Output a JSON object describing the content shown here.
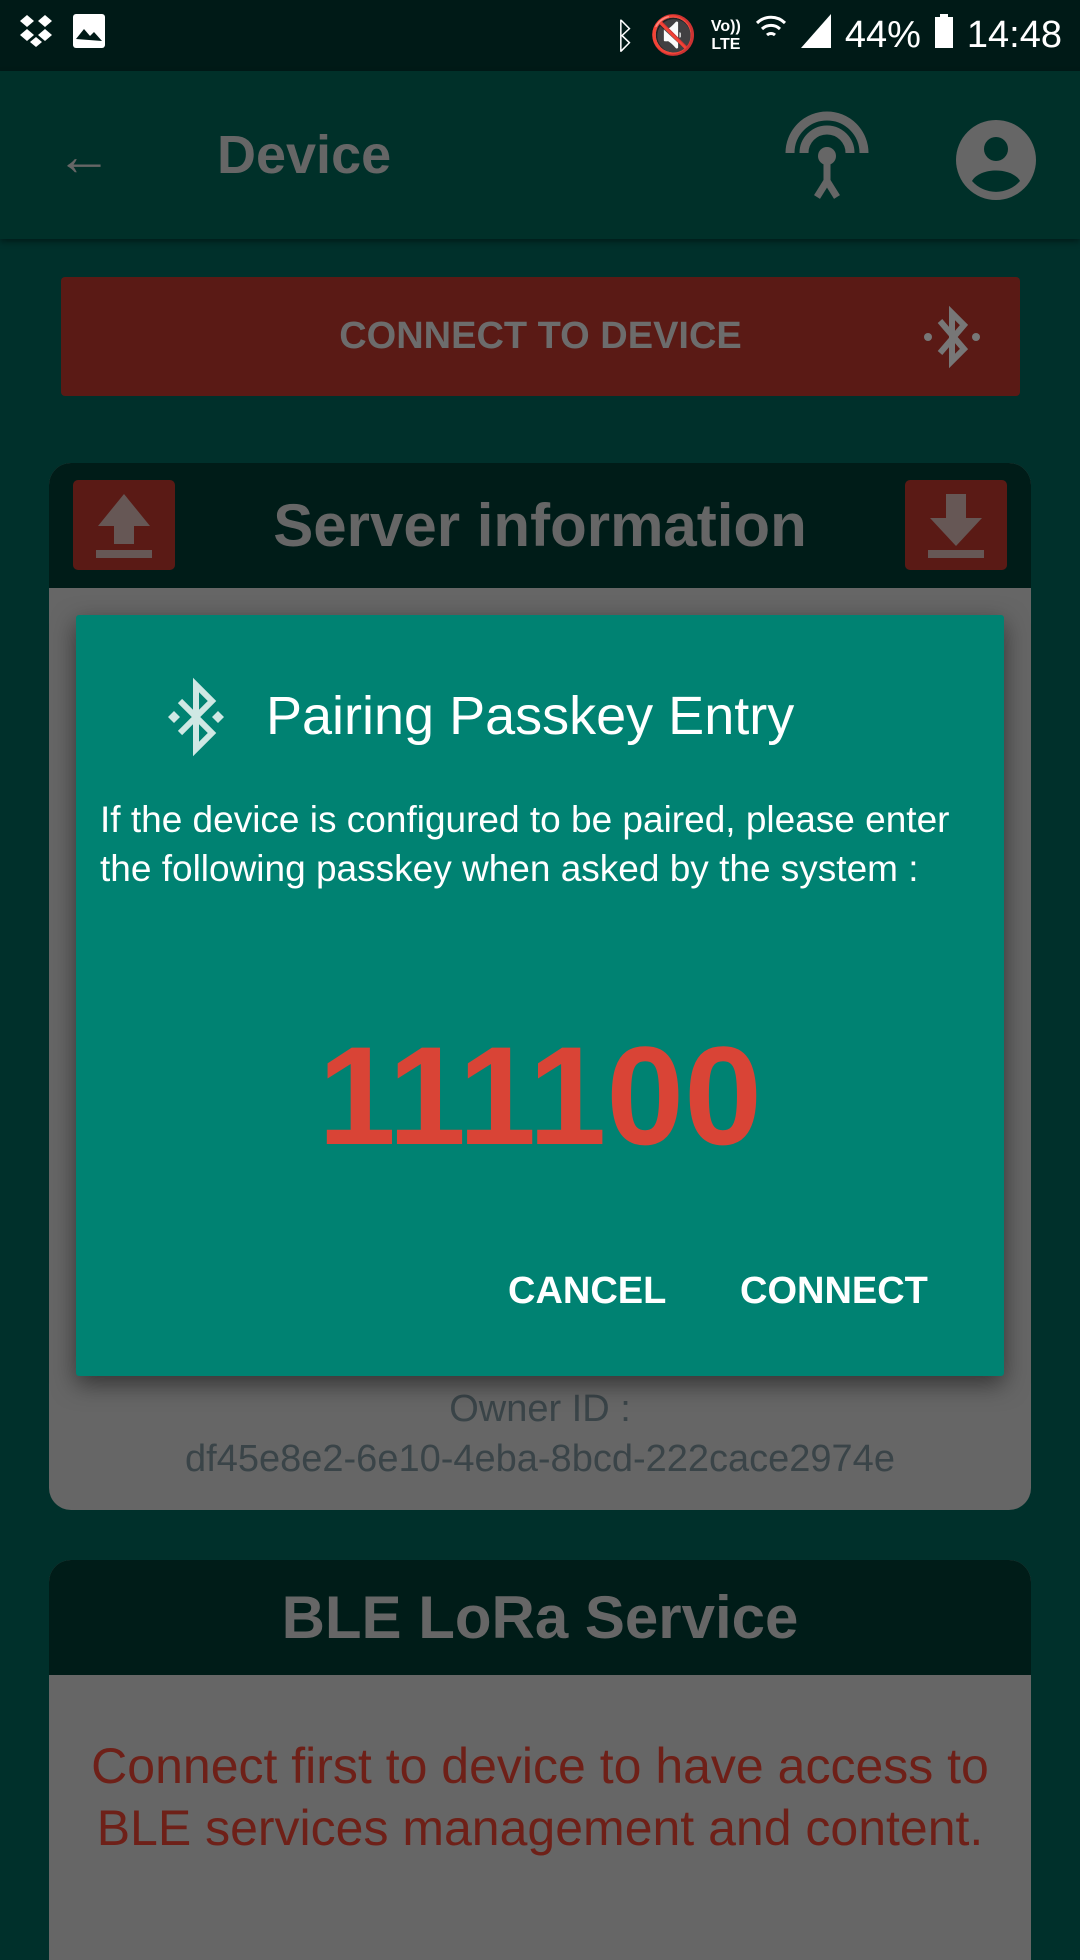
{
  "status_bar": {
    "battery": "44%",
    "time": "14:48",
    "network": "LTE",
    "volte": "Vo))"
  },
  "toolbar": {
    "title": "Device"
  },
  "connect_button": {
    "label": "CONNECT TO DEVICE"
  },
  "server_card": {
    "title": "Server information",
    "owner_label": "Owner ID :",
    "owner_id": "df45e8e2-6e10-4eba-8bcd-222cace2974e"
  },
  "ble_card": {
    "title": "BLE LoRa Service",
    "message": "Connect first to device to have access to BLE services management and content."
  },
  "dialog": {
    "title": "Pairing Passkey Entry",
    "body": "If the device is configured to be paired, please enter the following passkey when asked by the system :",
    "passkey": "111100",
    "cancel": "CANCEL",
    "connect": "CONNECT"
  },
  "colors": {
    "dialog": "#008272",
    "passkey": "#d94436",
    "background": "#00302b",
    "button": "#5a1a15"
  }
}
